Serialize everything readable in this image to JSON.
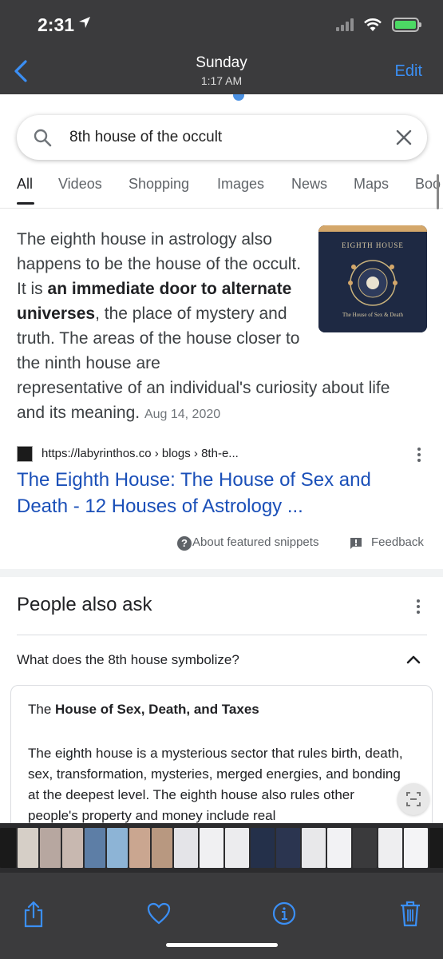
{
  "status": {
    "time": "2:31"
  },
  "nav": {
    "title": "Sunday",
    "subtitle": "1:17 AM",
    "edit_label": "Edit"
  },
  "search": {
    "query": "8th house of the occult"
  },
  "tabs": [
    "All",
    "Videos",
    "Shopping",
    "Images",
    "News",
    "Maps",
    "Boo"
  ],
  "snippet": {
    "text_1": "The eighth house in astrology also happens to be the house of the occult. It is ",
    "bold": "an immediate door to alternate universes",
    "text_2": ", the place of mystery and truth. The areas of the house closer to the ninth house are",
    "text_3": "representative of an individual's curiosity about life and its meaning.",
    "date": "Aug 14, 2020"
  },
  "thumbnail": {
    "title": "EIGHTH HOUSE",
    "caption": "The House of Sex & Death"
  },
  "result": {
    "url": "https://labyrinthos.co › blogs › 8th-e...",
    "title": "The Eighth House: The House of Sex and Death - 12 Houses of Astrology ..."
  },
  "footer": {
    "about": "About featured snippets",
    "feedback": "Feedback"
  },
  "paa": {
    "title": "People also ask",
    "question": "What does the 8th house symbolize?",
    "answer_prefix": "The ",
    "answer_bold": "House of Sex, Death, and Taxes",
    "answer_body": "The eighth house is a mysterious sector that rules birth, death, sex, transformation, mysteries, merged energies, and bonding at the deepest level. The eighth house also rules other people's property and money include real"
  },
  "colors": {
    "accent": "#3b8ff5",
    "link": "#1a4fb8",
    "bar": "#3b3b3d"
  }
}
